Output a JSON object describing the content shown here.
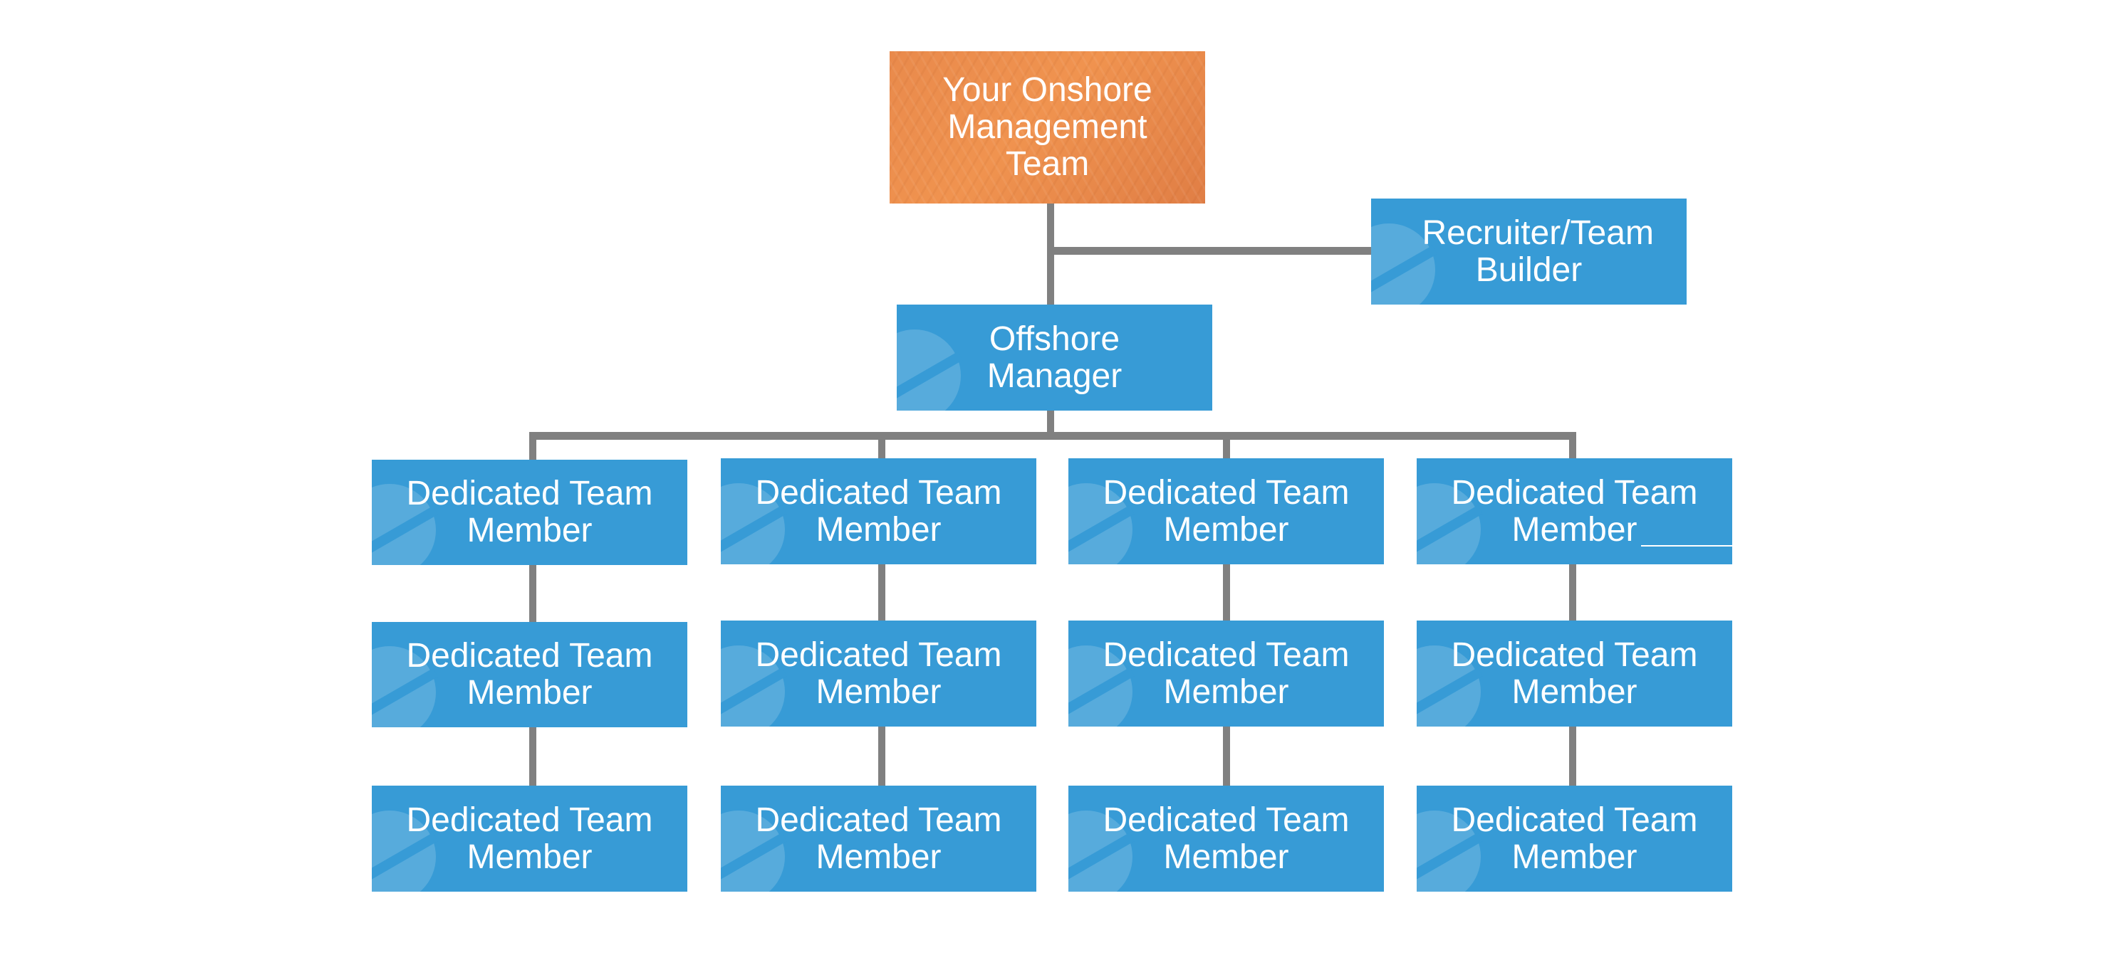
{
  "colors": {
    "node_blue": "#379bd6",
    "node_orange": "#ec8c4d",
    "connector": "#808080"
  },
  "top": {
    "label": "Your Onshore Management Team"
  },
  "recruiter": {
    "label": "Recruiter/Team Builder"
  },
  "manager": {
    "label": "Offshore Manager"
  },
  "columns": [
    {
      "members": [
        "Dedicated Team Member",
        "Dedicated Team Member",
        "Dedicated Team Member"
      ]
    },
    {
      "members": [
        "Dedicated Team Member",
        "Dedicated Team Member",
        "Dedicated Team Member"
      ]
    },
    {
      "members": [
        "Dedicated Team Member",
        "Dedicated Team Member",
        "Dedicated Team Member"
      ]
    },
    {
      "members": [
        "Dedicated Team Member",
        "Dedicated Team Member",
        "Dedicated Team Member"
      ]
    }
  ]
}
